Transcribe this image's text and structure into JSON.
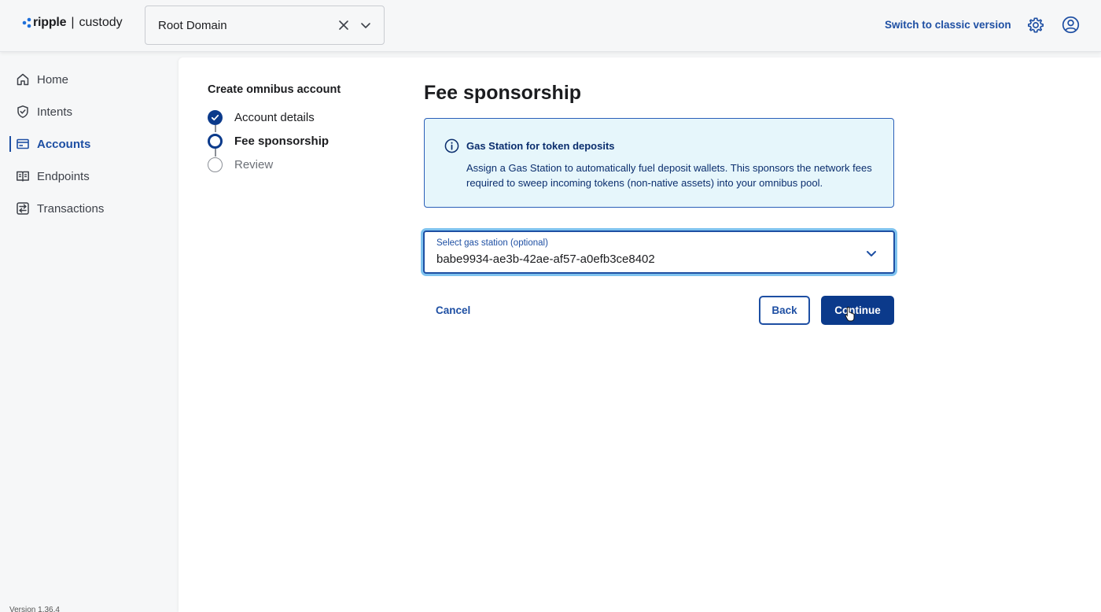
{
  "header": {
    "brand": "ripple",
    "product": "custody",
    "domain_select": {
      "value": "Root Domain"
    },
    "classic_link": "Switch to classic version",
    "icons": [
      "gear-icon",
      "user-circle-icon",
      "close-icon",
      "chevron-down-icon"
    ]
  },
  "sidebar": {
    "items": [
      {
        "label": "Home",
        "icon": "home-icon",
        "active": false
      },
      {
        "label": "Intents",
        "icon": "shield-icon",
        "active": false
      },
      {
        "label": "Accounts",
        "icon": "card-icon",
        "active": true
      },
      {
        "label": "Endpoints",
        "icon": "book-icon",
        "active": false
      },
      {
        "label": "Transactions",
        "icon": "transfer-icon",
        "active": false
      }
    ],
    "version": "Version 1.36.4"
  },
  "stepper": {
    "title": "Create omnibus account",
    "steps": [
      {
        "label": "Account details",
        "state": "done"
      },
      {
        "label": "Fee sponsorship",
        "state": "current"
      },
      {
        "label": "Review",
        "state": "pending"
      }
    ]
  },
  "main": {
    "title": "Fee sponsorship",
    "info": {
      "title": "Gas Station for token deposits",
      "text": "Assign a Gas Station to automatically fuel deposit wallets. This sponsors the network fees required to sweep incoming tokens (non-native assets) into your omnibus pool."
    },
    "gas_select": {
      "label": "Select gas station (optional)",
      "value": "babe9934-ae3b-42ae-af57-a0efb3ce8402"
    },
    "buttons": {
      "cancel": "Cancel",
      "back": "Back",
      "continue": "Continue"
    }
  },
  "colors": {
    "accent": "#1e4fa3",
    "primary_button": "#0b3a8b",
    "info_bg": "#e6f6fb",
    "focus_ring": "#7fc3ef"
  }
}
